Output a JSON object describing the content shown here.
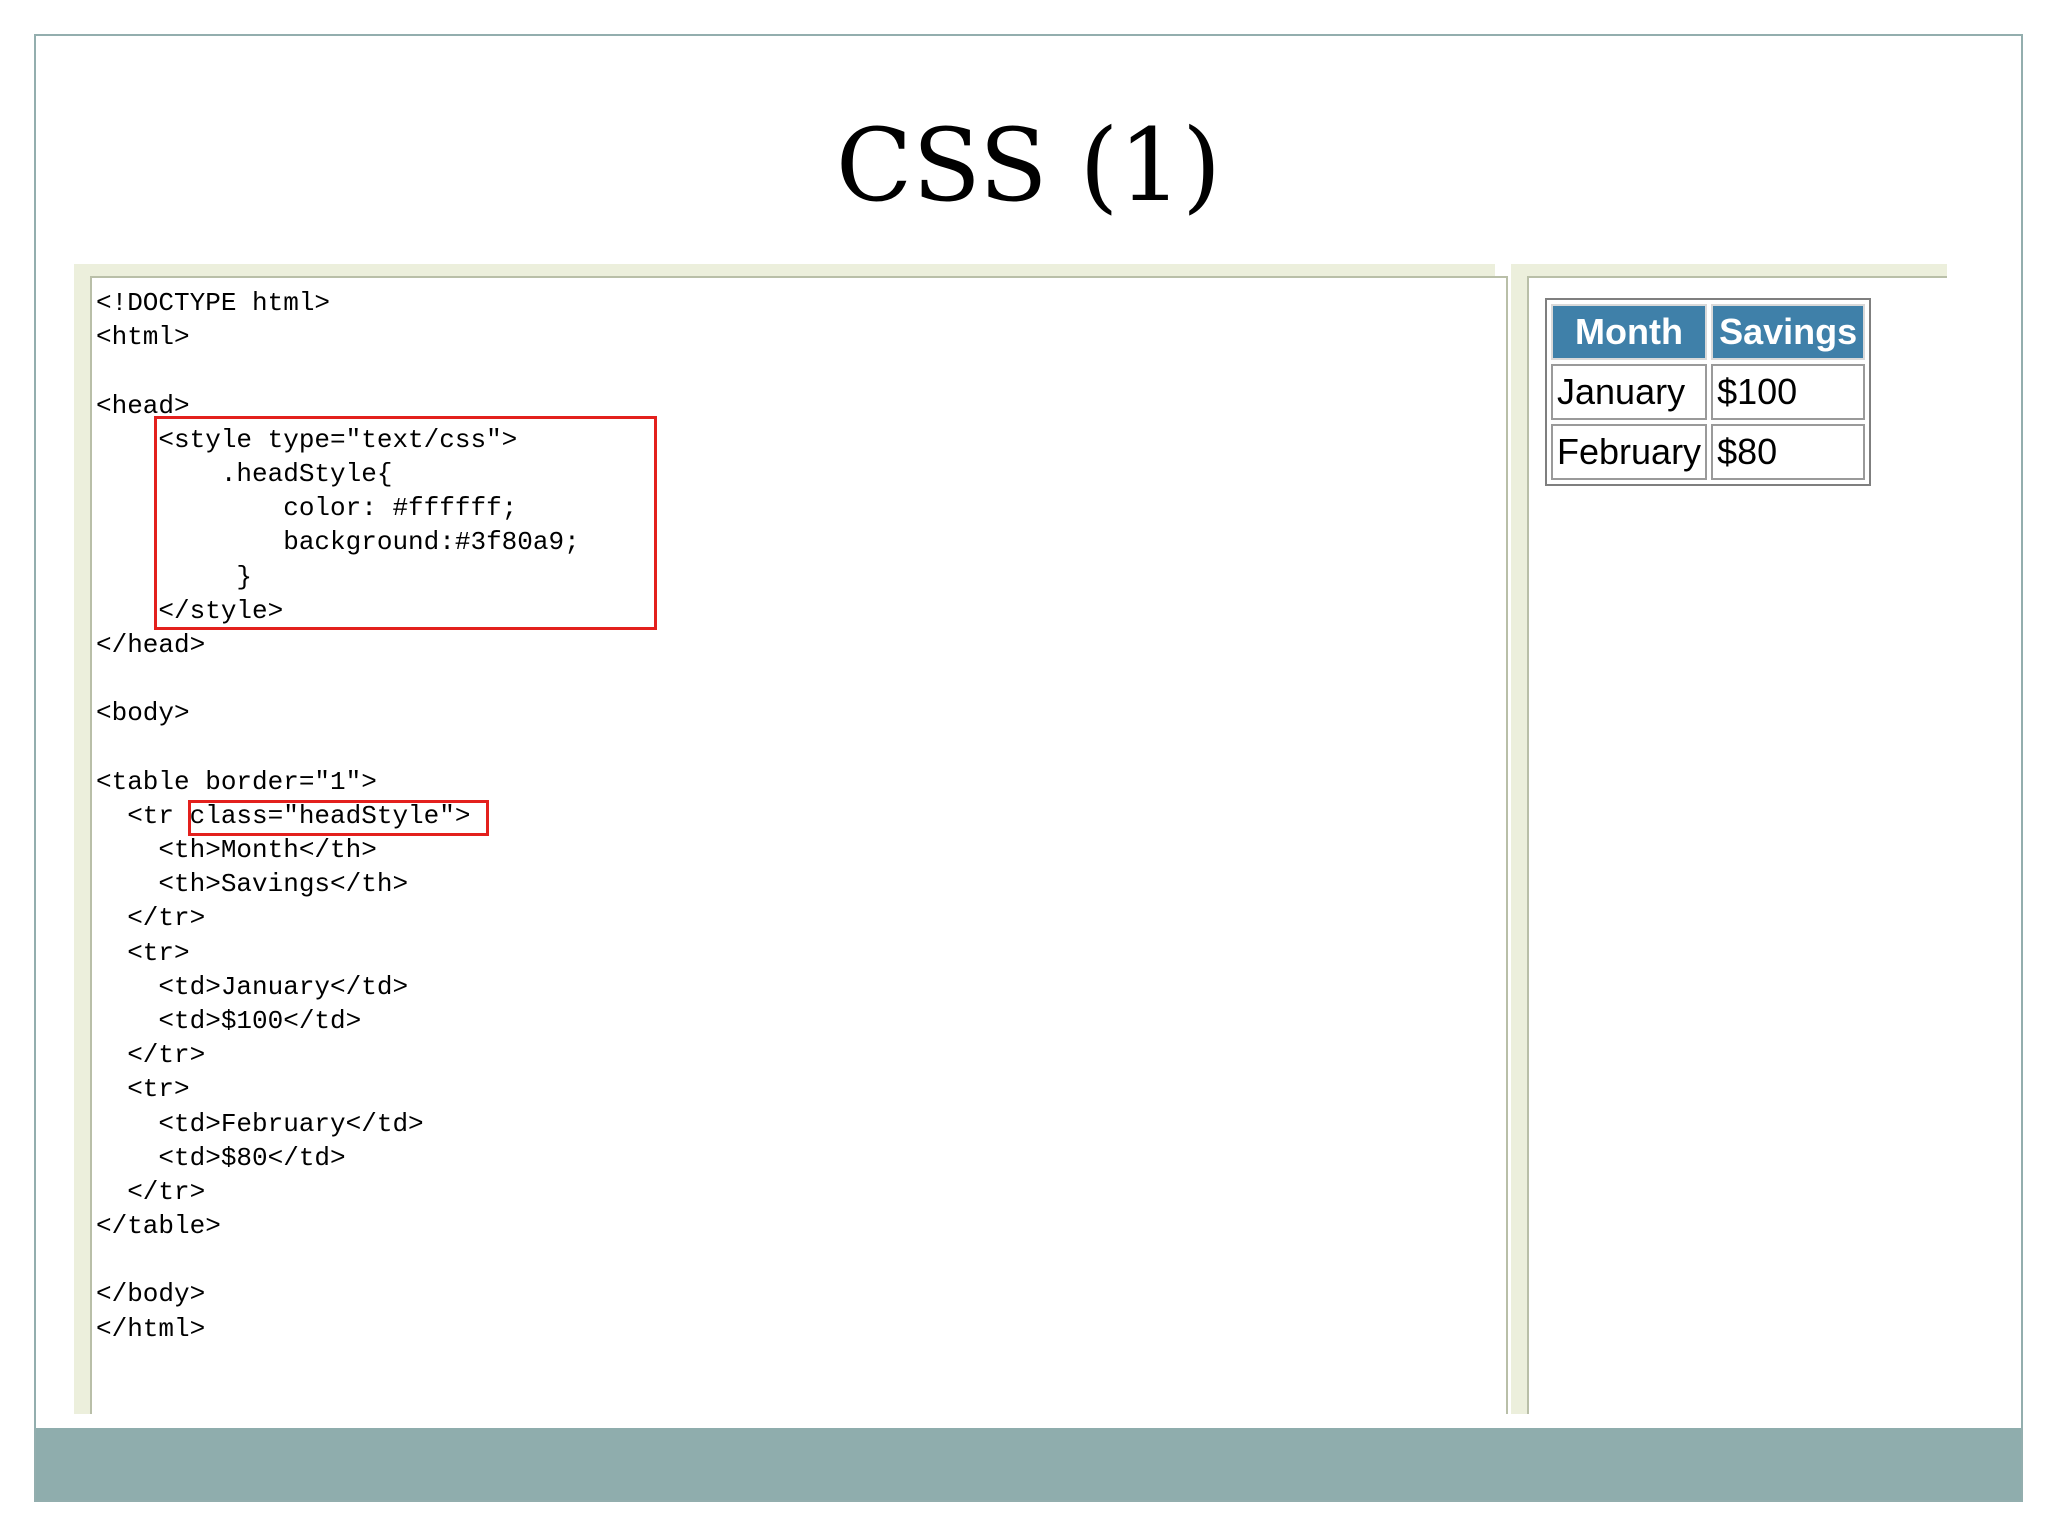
{
  "slide": {
    "title": "CSS (1)"
  },
  "code_lines": [
    "<!DOCTYPE html>",
    "<html>",
    "",
    "<head>",
    "    <style type=\"text/css\">",
    "        .headStyle{",
    "            color: #ffffff;",
    "            background:#3f80a9;",
    "         }",
    "    </style>",
    "</head>",
    "",
    "<body>",
    "",
    "<table border=\"1\">",
    "  <tr class=\"headStyle\">",
    "    <th>Month</th>",
    "    <th>Savings</th>",
    "  </tr>",
    "  <tr>",
    "    <td>January</td>",
    "    <td>$100</td>",
    "  </tr>",
    "  <tr>",
    "    <td>February</td>",
    "    <td>$80</td>",
    "  </tr>",
    "</table>",
    "",
    "</body>",
    "</html>"
  ],
  "preview_table": {
    "headers": [
      "Month",
      "Savings"
    ],
    "rows": [
      [
        "January",
        "$100"
      ],
      [
        "February",
        "$80"
      ]
    ]
  },
  "colors": {
    "header_background": "#3f80a9",
    "header_text": "#ffffff",
    "highlight_border": "#e3201d",
    "footer_band": "#8fadad"
  }
}
